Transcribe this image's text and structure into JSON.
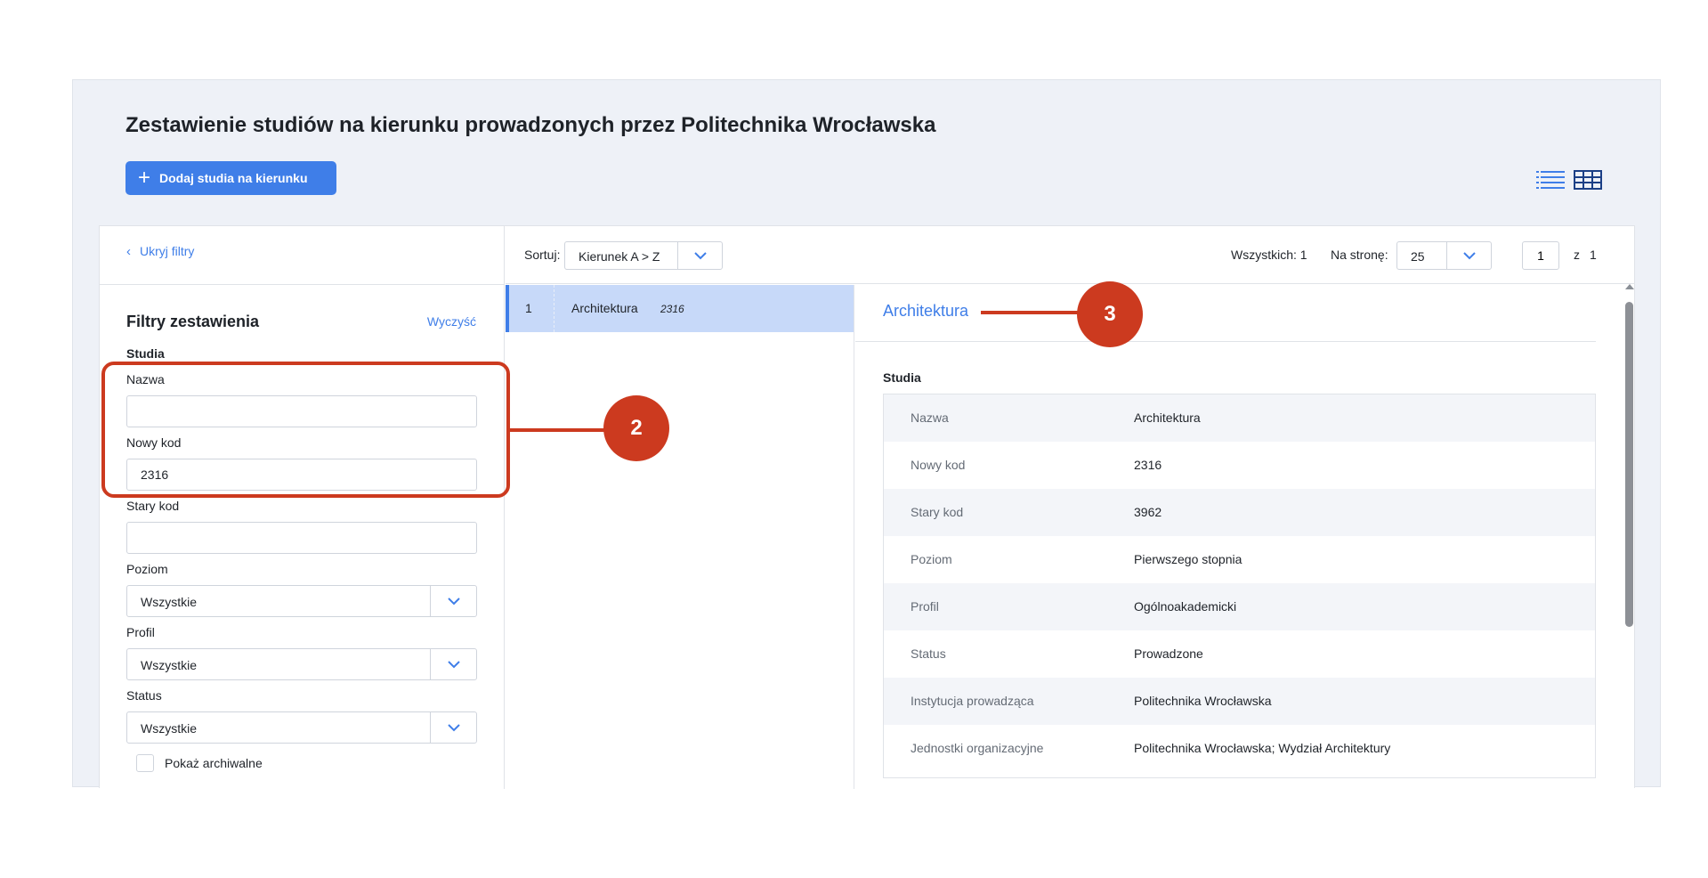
{
  "header": {
    "title": "Zestawienie studiów na kierunku prowadzonych przez Politechnika Wrocławska",
    "add_button": "Dodaj studia na kierunku",
    "view_list_icon": "list-view-icon",
    "view_table_icon": "table-view-icon"
  },
  "filters": {
    "hide_label": "Ukryj filtry",
    "title": "Filtry zestawienia",
    "clear_label": "Wyczyść",
    "section": "Studia",
    "name_label": "Nazwa",
    "name_value": "",
    "new_code_label": "Nowy kod",
    "new_code_value": "2316",
    "old_code_label": "Stary kod",
    "old_code_value": "",
    "level_label": "Poziom",
    "level_value": "Wszystkie",
    "profile_label": "Profil",
    "profile_value": "Wszystkie",
    "status_label": "Status",
    "status_value": "Wszystkie",
    "archive_label": "Pokaż archiwalne",
    "archive_checked": false
  },
  "toolbar": {
    "sort_label": "Sortuj:",
    "sort_value": "Kierunek A > Z",
    "total_label": "Wszystkich: 1",
    "per_page_label": "Na stronę:",
    "per_page_value": "25",
    "page_value": "1",
    "page_of": "z",
    "page_total": "1"
  },
  "list": {
    "items": [
      {
        "num": "1",
        "name": "Architektura",
        "code": "2316"
      }
    ]
  },
  "detail": {
    "title": "Architektura",
    "section": "Studia",
    "rows": [
      {
        "key": "Nazwa",
        "value": "Architektura"
      },
      {
        "key": "Nowy kod",
        "value": "2316"
      },
      {
        "key": "Stary kod",
        "value": "3962"
      },
      {
        "key": "Poziom",
        "value": "Pierwszego stopnia"
      },
      {
        "key": "Profil",
        "value": "Ogólnoakademicki"
      },
      {
        "key": "Status",
        "value": "Prowadzone"
      },
      {
        "key": "Instytucja prowadząca",
        "value": "Politechnika Wrocławska"
      },
      {
        "key": "Jednostki organizacyjne",
        "value": "Politechnika Wrocławska; Wydział Architektury"
      }
    ]
  },
  "annotations": {
    "callout_2": "2",
    "callout_3": "3"
  },
  "colors": {
    "accent": "#3f7ee8",
    "selected_row": "#c7d9f9",
    "callout": "#cc3a1f",
    "frame_bg": "#eef1f7"
  }
}
